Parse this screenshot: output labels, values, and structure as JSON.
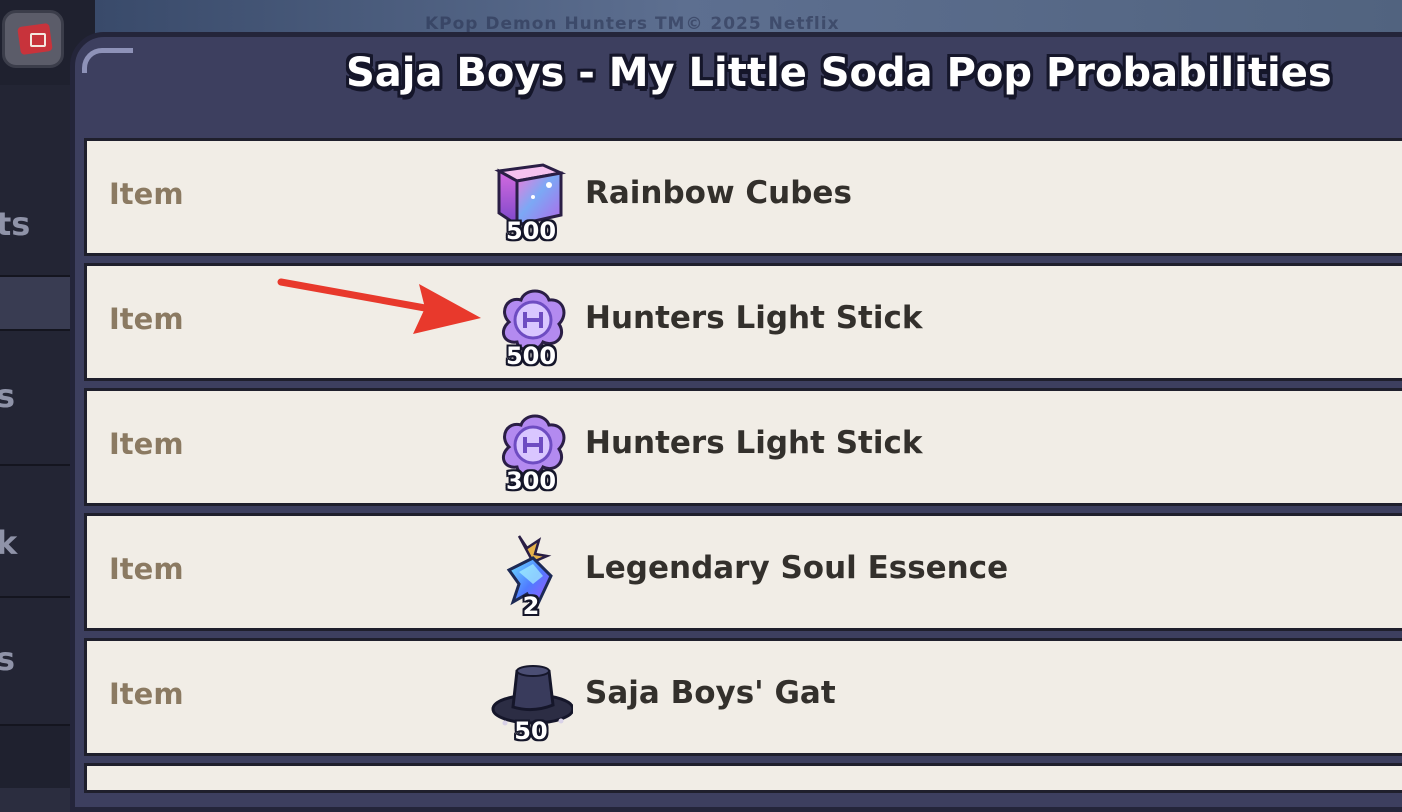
{
  "watermark": "KPop Demon Hunters TM© 2025 Netflix",
  "sidebar": {
    "letters": [
      "ts",
      "",
      "s",
      "k",
      "s"
    ]
  },
  "dialog": {
    "title": "Saja Boys - My Little Soda Pop Probabilities"
  },
  "items": [
    {
      "type": "Item",
      "icon": "rainbow-cube-icon",
      "qty": "500",
      "name": "Rainbow Cubes"
    },
    {
      "type": "Item",
      "icon": "light-stick-icon",
      "qty": "500",
      "name": "Hunters Light Stick"
    },
    {
      "type": "Item",
      "icon": "light-stick-icon",
      "qty": "300",
      "name": "Hunters Light Stick"
    },
    {
      "type": "Item",
      "icon": "soul-essence-icon",
      "qty": "2",
      "name": "Legendary Soul Essence"
    },
    {
      "type": "Item",
      "icon": "gat-hat-icon",
      "qty": "50",
      "name": "Saja Boys' Gat"
    }
  ],
  "annotation": {
    "icon": "red-arrow-icon",
    "color": "#e8392c",
    "points_to_row": 1
  },
  "colors": {
    "dialog_bg": "#3d3f5f",
    "row_bg": "#f1ede6",
    "type_text": "#8b7a62",
    "name_text": "#33302c"
  }
}
